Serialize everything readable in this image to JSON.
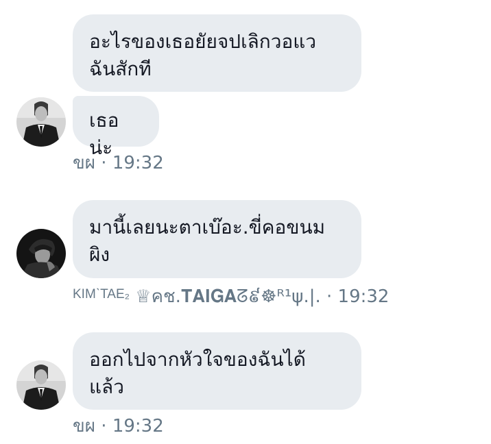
{
  "conversation": {
    "messages": [
      {
        "bubbles": [
          "อะไรของเธอยัยจปเลิกวอแว\nฉันสักที",
          "เธอน่ะ"
        ],
        "sender": "ขผ",
        "time": "19:32"
      },
      {
        "bubbles": [
          "มานี้เลยนะตาเบ๊อะ.ขี่คอขนม\nผิง"
        ],
        "sender_tag": "KIMˋTAE₂",
        "sender": "♕คช.𝐓𝐀𝐈𝐆𝐀ᘔ៩☸ᴿ¹ψ.|.",
        "time": "19:32"
      },
      {
        "bubbles": [
          "ออกไปจากหัวใจของฉันได้\nแล้ว"
        ],
        "sender": "ขผ",
        "time": "19:32"
      }
    ],
    "separator": "·"
  },
  "colors": {
    "bubble": "#e8ecf0",
    "meta_text": "#657786",
    "message_text": "#141823"
  }
}
